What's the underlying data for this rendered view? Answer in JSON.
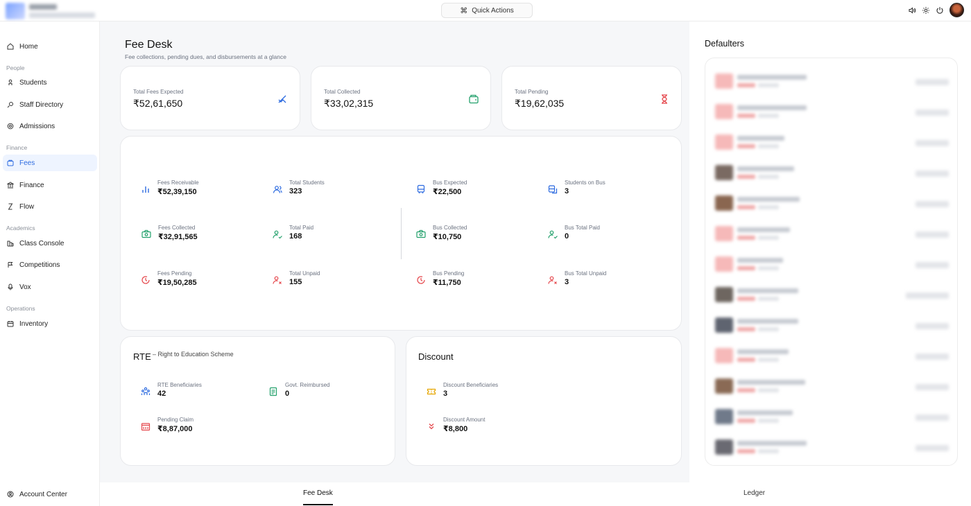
{
  "header": {
    "quick_actions": "Quick Actions",
    "icons": [
      "volume-icon",
      "settings-icon",
      "power-icon",
      "user-avatar"
    ]
  },
  "sidebar": {
    "home": "Home",
    "section_people": "People",
    "students": "Students",
    "staff_directory": "Staff Directory",
    "admissions": "Admissions",
    "section_finance": "Finance",
    "fees": "Fees",
    "finance": "Finance",
    "flow": "Flow",
    "section_academics": "Academics",
    "class_console": "Class Console",
    "competitions": "Competitions",
    "vox": "Vox",
    "section_operations": "Operations",
    "inventory": "Inventory",
    "account_center": "Account Center"
  },
  "page": {
    "title": "Fee Desk",
    "subtitle": "Fee collections, pending dues, and disbursements at a glance"
  },
  "summary": {
    "expected_label": "Total Fees Expected",
    "expected_value": "₹52,61,650",
    "collected_label": "Total Collected",
    "collected_value": "₹33,02,315",
    "pending_label": "Total Pending",
    "pending_value": "₹19,62,035"
  },
  "metrics": {
    "fees_receivable_label": "Fees Receivable",
    "fees_receivable_value": "₹52,39,150",
    "total_students_label": "Total Students",
    "total_students_value": "323",
    "bus_expected_label": "Bus Expected",
    "bus_expected_value": "₹22,500",
    "students_on_bus_label": "Students on Bus",
    "students_on_bus_value": "3",
    "fees_collected_label": "Fees Collected",
    "fees_collected_value": "₹32,91,565",
    "total_paid_label": "Total Paid",
    "total_paid_value": "168",
    "bus_collected_label": "Bus Collected",
    "bus_collected_value": "₹10,750",
    "bus_total_paid_label": "Bus Total Paid",
    "bus_total_paid_value": "0",
    "fees_pending_label": "Fees Pending",
    "fees_pending_value": "₹19,50,285",
    "total_unpaid_label": "Total Unpaid",
    "total_unpaid_value": "155",
    "bus_pending_label": "Bus Pending",
    "bus_pending_value": "₹11,750",
    "bus_total_unpaid_label": "Bus Total Unpaid",
    "bus_total_unpaid_value": "3"
  },
  "rte": {
    "title": "RTE",
    "subtitle": "– Right to Education Scheme",
    "beneficiaries_label": "RTE Beneficiaries",
    "beneficiaries_value": "42",
    "reimbursed_label": "Govt. Reimbursed",
    "reimbursed_value": "0",
    "pending_claim_label": "Pending Claim",
    "pending_claim_value": "₹8,87,000"
  },
  "discount": {
    "title": "Discount",
    "beneficiaries_label": "Discount Beneficiaries",
    "beneficiaries_value": "3",
    "amount_label": "Discount Amount",
    "amount_value": "₹8,800"
  },
  "defaulters": {
    "title": "Defaulters"
  },
  "tabs": {
    "fee_desk": "Fee Desk",
    "ledger": "Ledger"
  },
  "colors": {
    "accent": "#2d6be0",
    "green": "#22a06b",
    "red": "#e5484d",
    "yellow": "#e6a700"
  }
}
